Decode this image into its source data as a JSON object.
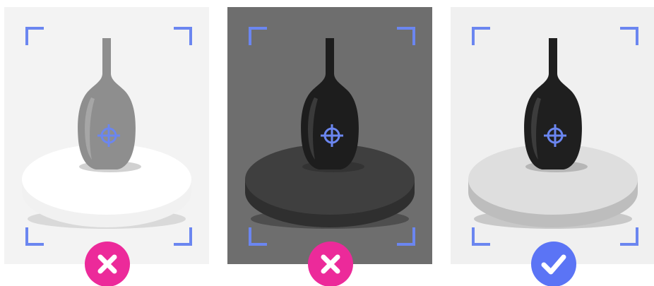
{
  "panels": [
    {
      "id": "overexposed",
      "verdict": "reject",
      "badge_icon": "cross-icon",
      "background": "#f3f3f3",
      "turntable_top": "#ffffff",
      "turntable_side": "#f1f1f1",
      "turntable_shadow": "#d9d9d9",
      "vase_color": "#8e8e8e",
      "vase_highlight": "#a6a6a6",
      "badge_color": "#ec2a9a"
    },
    {
      "id": "underexposed",
      "verdict": "reject",
      "badge_icon": "cross-icon",
      "background": "#6e6e6e",
      "turntable_top": "#3f3f3f",
      "turntable_side": "#2f2f2f",
      "turntable_shadow": "#4e4e4e",
      "vase_color": "#1d1d1d",
      "vase_highlight": "#3a3a3a",
      "badge_color": "#ec2a9a"
    },
    {
      "id": "correct-exposure",
      "verdict": "accept",
      "badge_icon": "checkmark-icon",
      "background": "#f0f0f0",
      "turntable_top": "#dedede",
      "turntable_side": "#bdbdbd",
      "turntable_shadow": "#c8c8c8",
      "vase_color": "#1f1f1f",
      "vase_highlight": "#3c3c3c",
      "badge_color": "#5b74f5"
    }
  ],
  "accent_color": "#6b86f0",
  "icons": {
    "corner": "focus-corner-icon",
    "target": "crosshair-target-icon",
    "reject": "cross-icon",
    "accept": "checkmark-icon"
  }
}
